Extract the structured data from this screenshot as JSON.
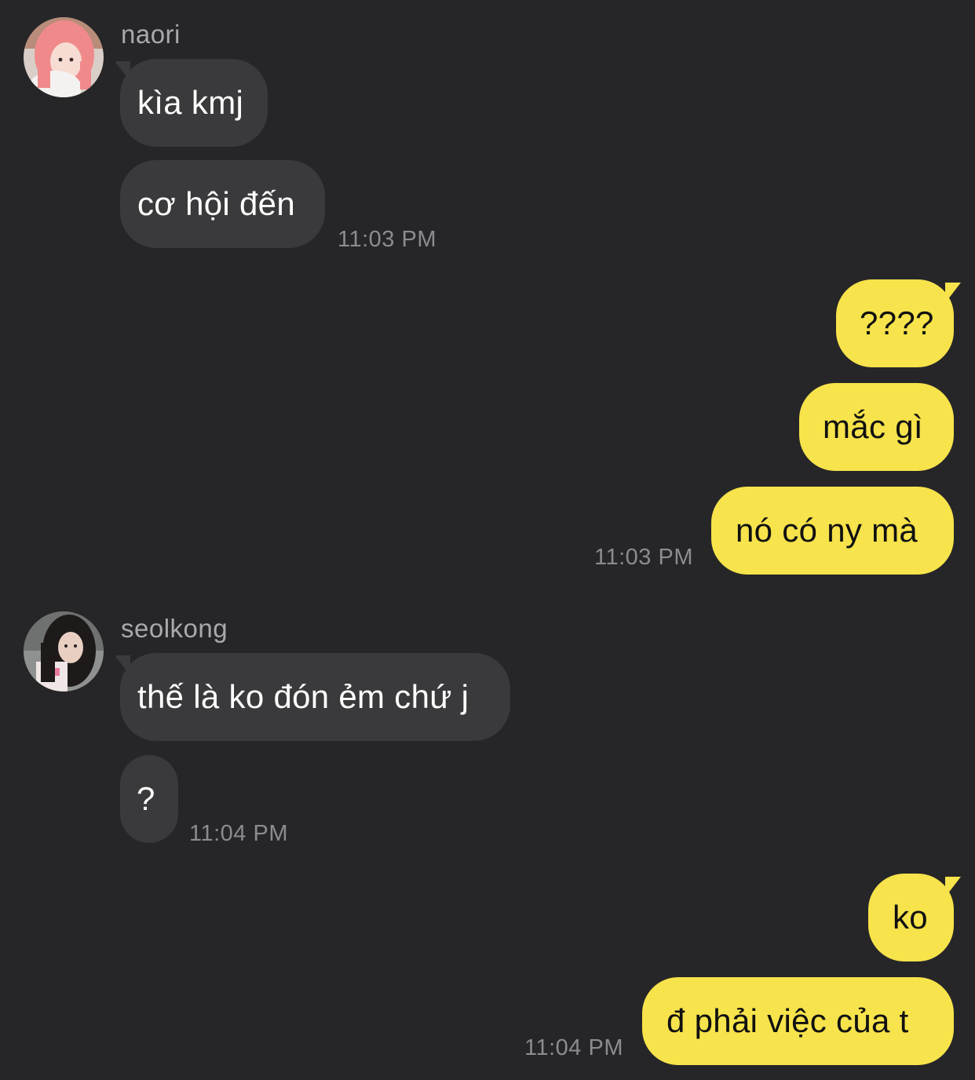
{
  "colors": {
    "background": "#262628",
    "incoming_bubble": "#3a3a3c",
    "outgoing_bubble": "#f7e34b",
    "timestamp": "#8c8c90",
    "sender_name": "#a9a9ad"
  },
  "groups": [
    {
      "sender": "naori",
      "avatar_icon": "profile-photo-pink-hair",
      "messages": [
        "kìa kmj",
        "cơ hội đến"
      ],
      "time": "11:03 PM"
    },
    {
      "sender": "me",
      "messages": [
        "????",
        "mắc gì",
        "nó có ny mà"
      ],
      "time": "11:03 PM"
    },
    {
      "sender": "seolkong",
      "avatar_icon": "profile-photo-dark-hair",
      "messages": [
        "thế là ko đón ẻm chứ j",
        "?"
      ],
      "time": "11:04 PM"
    },
    {
      "sender": "me",
      "messages": [
        "ko",
        "đ phải việc của t"
      ],
      "time": "11:04 PM"
    }
  ]
}
